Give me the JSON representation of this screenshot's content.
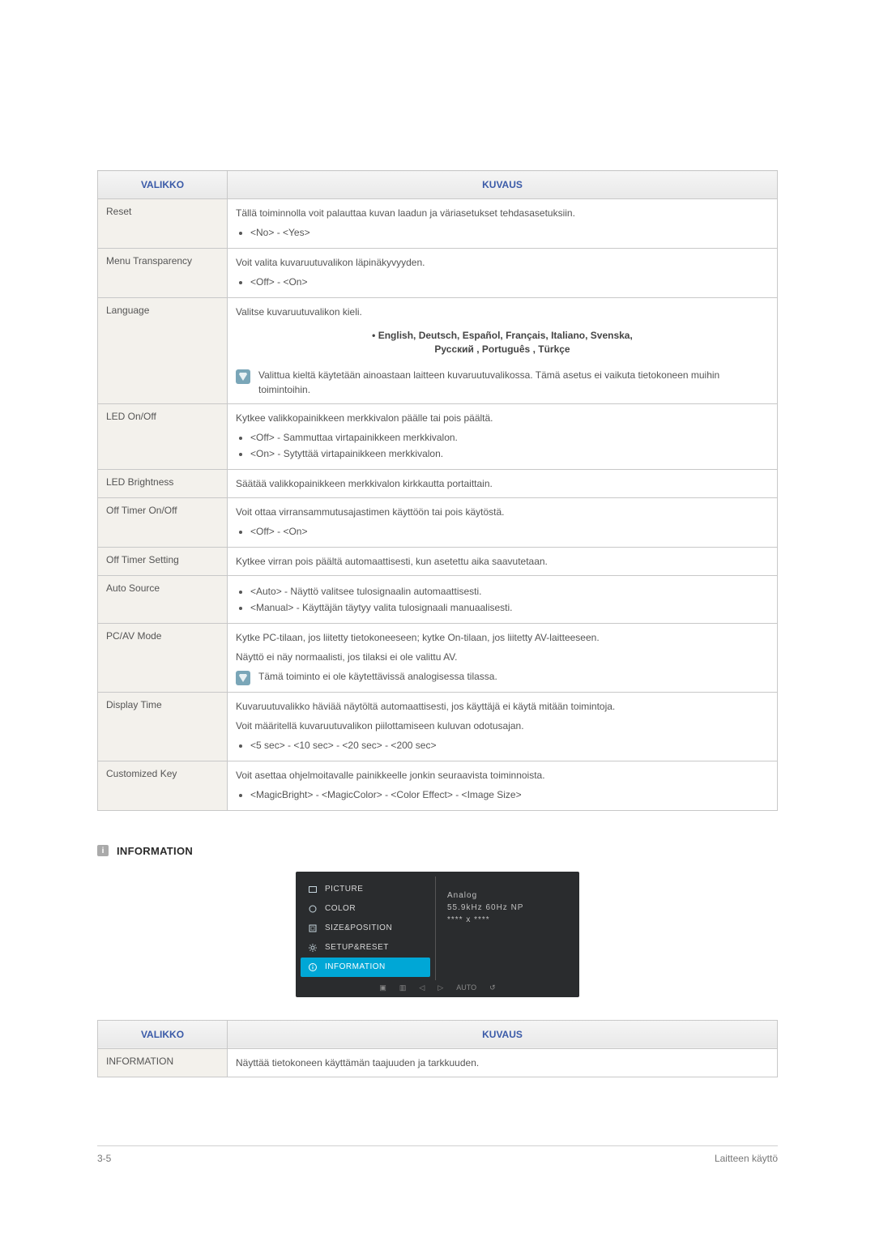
{
  "table1": {
    "headers": {
      "menu": "VALIKKO",
      "desc": "KUVAUS"
    },
    "rows": {
      "reset": {
        "menu": "Reset",
        "intro": "Tällä toiminnolla voit palauttaa kuvan laadun ja väriasetukset tehdasasetuksiin.",
        "bullets": [
          "<No> - <Yes>"
        ]
      },
      "menu_transparency": {
        "menu": "Menu Transparency",
        "intro": "Voit valita kuvaruutuvalikon läpinäkyvyyden.",
        "bullets": [
          "<Off> - <On>"
        ]
      },
      "language": {
        "menu": "Language",
        "intro": "Valitse kuvaruutuvalikon kieli.",
        "langs_line1": "• English, Deutsch, Español, Français,  Italiano, Svenska,",
        "langs_line2": "Русский , Português , Türkçe",
        "note": "Valittua kieltä käytetään ainoastaan laitteen kuvaruutuvalikossa. Tämä asetus ei vaikuta tietokoneen muihin toimintoihin."
      },
      "led_onoff": {
        "menu": "LED On/Off",
        "intro": "Kytkee valikkopainikkeen merkkivalon päälle tai pois päältä.",
        "bullets": [
          "<Off> - Sammuttaa virtapainikkeen merkkivalon.",
          "<On> - Sytyttää virtapainikkeen merkkivalon."
        ]
      },
      "led_brightness": {
        "menu": "LED Brightness",
        "intro": "Säätää valikkopainikkeen merkkivalon kirkkautta portaittain."
      },
      "off_timer_onoff": {
        "menu": "Off Timer On/Off",
        "intro": "Voit ottaa virransammutusajastimen käyttöön tai pois käytöstä.",
        "bullets": [
          "<Off> - <On>"
        ]
      },
      "off_timer_setting": {
        "menu": "Off Timer Setting",
        "intro": "Kytkee virran pois päältä automaattisesti, kun asetettu aika saavutetaan."
      },
      "auto_source": {
        "menu": "Auto Source",
        "bullets": [
          "<Auto> - Näyttö valitsee tulosignaalin automaattisesti.",
          "<Manual> - Käyttäjän täytyy valita tulosignaali manuaalisesti."
        ]
      },
      "pcav": {
        "menu": "PC/AV Mode",
        "intro": "Kytke PC-tilaan, jos liitetty tietokoneeseen; kytke On-tilaan, jos liitetty AV-laitteeseen.",
        "line2": "Näyttö ei näy normaalisti, jos tilaksi ei ole valittu AV.",
        "note": "Tämä toiminto ei ole käytettävissä analogisessa tilassa."
      },
      "display_time": {
        "menu": "Display Time",
        "intro": "Kuvaruutuvalikko häviää näytöltä automaattisesti, jos käyttäjä ei käytä mitään toimintoja.",
        "line2": "Voit määritellä kuvaruutuvalikon piilottamiseen kuluvan odotusajan.",
        "bullets": [
          "<5 sec> - <10 sec> - <20 sec> - <200 sec>"
        ]
      },
      "customized_key": {
        "menu": "Customized Key",
        "intro": "Voit asettaa ohjelmoitavalle painikkeelle jonkin seuraavista toiminnoista.",
        "bullets": [
          "<MagicBright> - <MagicColor> - <Color Effect> - <Image Size>"
        ]
      }
    }
  },
  "section2": {
    "title": "INFORMATION",
    "osd": {
      "items": [
        "PICTURE",
        "COLOR",
        "SIZE&POSITION",
        "SETUP&RESET",
        "INFORMATION"
      ],
      "right_lines": [
        "Analog",
        "55.9kHz 60Hz NP",
        "**** x ****"
      ],
      "footer_icons": [
        "▣",
        "▥",
        "◁",
        "▷",
        "AUTO",
        "↺"
      ]
    }
  },
  "table2": {
    "headers": {
      "menu": "VALIKKO",
      "desc": "KUVAUS"
    },
    "row": {
      "menu": "INFORMATION",
      "desc": "Näyttää tietokoneen käyttämän taajuuden ja tarkkuuden."
    }
  },
  "footer": {
    "left": "3-5",
    "right": "Laitteen käyttö"
  }
}
